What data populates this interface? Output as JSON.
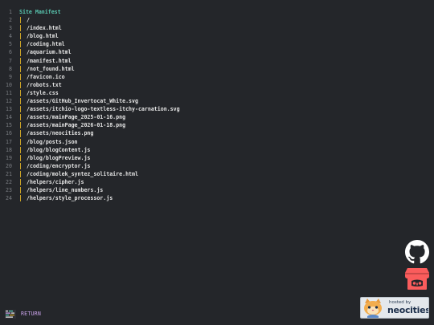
{
  "manifest": {
    "heading": "Site Manifest",
    "lines": [
      "/",
      "/index.html",
      "/blog.html",
      "/coding.html",
      "/aquarium.html",
      "/manifest.html",
      "/not_found.html",
      "/favicon.ico",
      "/robots.txt",
      "/style.css",
      "/assets/GitHub_Invertocat_White.svg",
      "/assets/itchio-logo-textless-itchy-carnation.svg",
      "/assets/mainPage_2025-01-16.png",
      "/assets/mainPage_2026-01-18.png",
      "/assets/neocities.png",
      "/blog/posts.json",
      "/blog/blogContent.js",
      "/blog/blogPreview.js",
      "/coding/encryptor.js",
      "/coding/molek_syntez_solitaire.html",
      "/helpers/cipher.js",
      "/helpers/line_numbers.js",
      "/helpers/style_processor.js"
    ]
  },
  "footer": {
    "return_label": "RETURN",
    "return_icon": "return-icon"
  },
  "links": {
    "github_icon": "github-icon",
    "itch_icon": "itchio-icon"
  },
  "badge": {
    "hosted_by": "hosted by",
    "name": "neocities"
  },
  "colors": {
    "background": "#24262a",
    "heading": "#59c7b0",
    "guide": "#c9a227",
    "line_number": "#7a7d82",
    "text": "#e6e6e6",
    "return_label": "#c8a2e8",
    "itch_red": "#fa5c5c"
  }
}
